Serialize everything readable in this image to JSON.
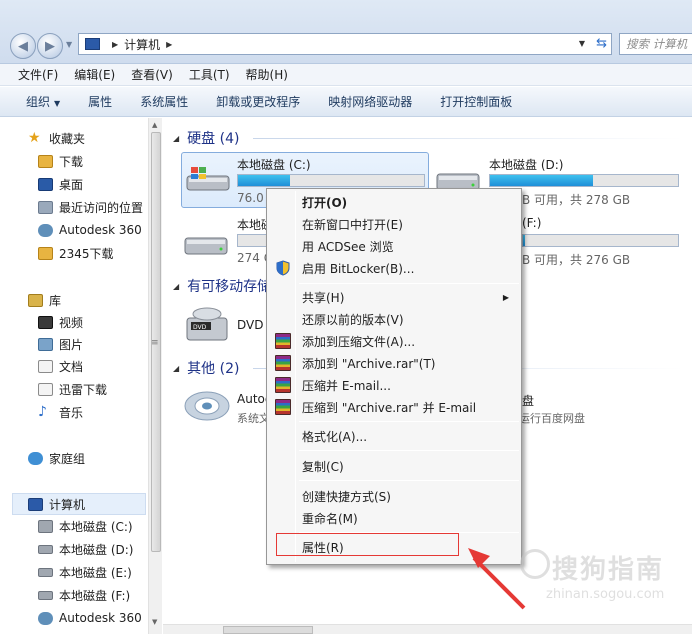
{
  "address": {
    "path": "计算机",
    "search_placeholder": "搜索 计算机"
  },
  "menubar": {
    "items": [
      "文件(F)",
      "编辑(E)",
      "查看(V)",
      "工具(T)",
      "帮助(H)"
    ]
  },
  "toolbar": {
    "items": [
      "组织",
      "属性",
      "系统属性",
      "卸载或更改程序",
      "映射网络驱动器",
      "打开控制面板"
    ]
  },
  "sidebar": {
    "favorites": [
      "收藏夹",
      "下载",
      "桌面",
      "最近访问的位置",
      "Autodesk 360",
      "2345下载"
    ],
    "libraries": [
      "库",
      "视频",
      "图片",
      "文档",
      "迅雷下载",
      "音乐"
    ],
    "homegroup": "家庭组",
    "computer": [
      "计算机",
      "本地磁盘 (C:)",
      "本地磁盘 (D:)",
      "本地磁盘 (E:)",
      "本地磁盘 (F:)",
      "Autodesk 360"
    ]
  },
  "content": {
    "hard_disks_header": "硬盘 (4)",
    "removable_header": "有可移动存储",
    "other_header": "其他 (2)",
    "drives": [
      {
        "name": "本地磁盘 (C:)",
        "info": "76.0",
        "fill": 0.28
      },
      {
        "name": "本地磁盘 (D:)",
        "info": "B 可用，共 278 GB",
        "fill": 0.55
      },
      {
        "name": "本地磁",
        "info": "274 G",
        "fill": 0.01
      },
      {
        "name": "(F:)",
        "info": "B 可用，共 276 GB",
        "fill": 0.01
      }
    ],
    "dvd_name": "DVD",
    "other_items": [
      {
        "name": "Autod",
        "sub": "系统文"
      },
      {
        "name": "盘",
        "sub": "运行百度网盘"
      }
    ]
  },
  "context_menu": {
    "items": [
      {
        "label": "打开(O)",
        "bold": true
      },
      {
        "label": "在新窗口中打开(E)"
      },
      {
        "label": "用 ACDSee 浏览"
      },
      {
        "label": "启用 BitLocker(B)..."
      },
      {
        "label": "共享(H)"
      },
      {
        "label": "还原以前的版本(V)"
      },
      {
        "label": "添加到压缩文件(A)..."
      },
      {
        "label": "添加到 \"Archive.rar\"(T)"
      },
      {
        "label": "压缩并 E-mail..."
      },
      {
        "label": "压缩到 \"Archive.rar\" 并 E-mail"
      },
      {
        "label": "格式化(A)..."
      },
      {
        "label": "复制(C)"
      },
      {
        "label": "创建快捷方式(S)"
      },
      {
        "label": "重命名(M)"
      },
      {
        "label": "属性(R)"
      }
    ]
  },
  "watermark": {
    "text": "搜狗指南",
    "url": "zhinan.sogou.com"
  },
  "colors": {
    "accent": "#1e3287",
    "highlight_red": "#e53935",
    "bar_fill": "#1f8fd8"
  }
}
